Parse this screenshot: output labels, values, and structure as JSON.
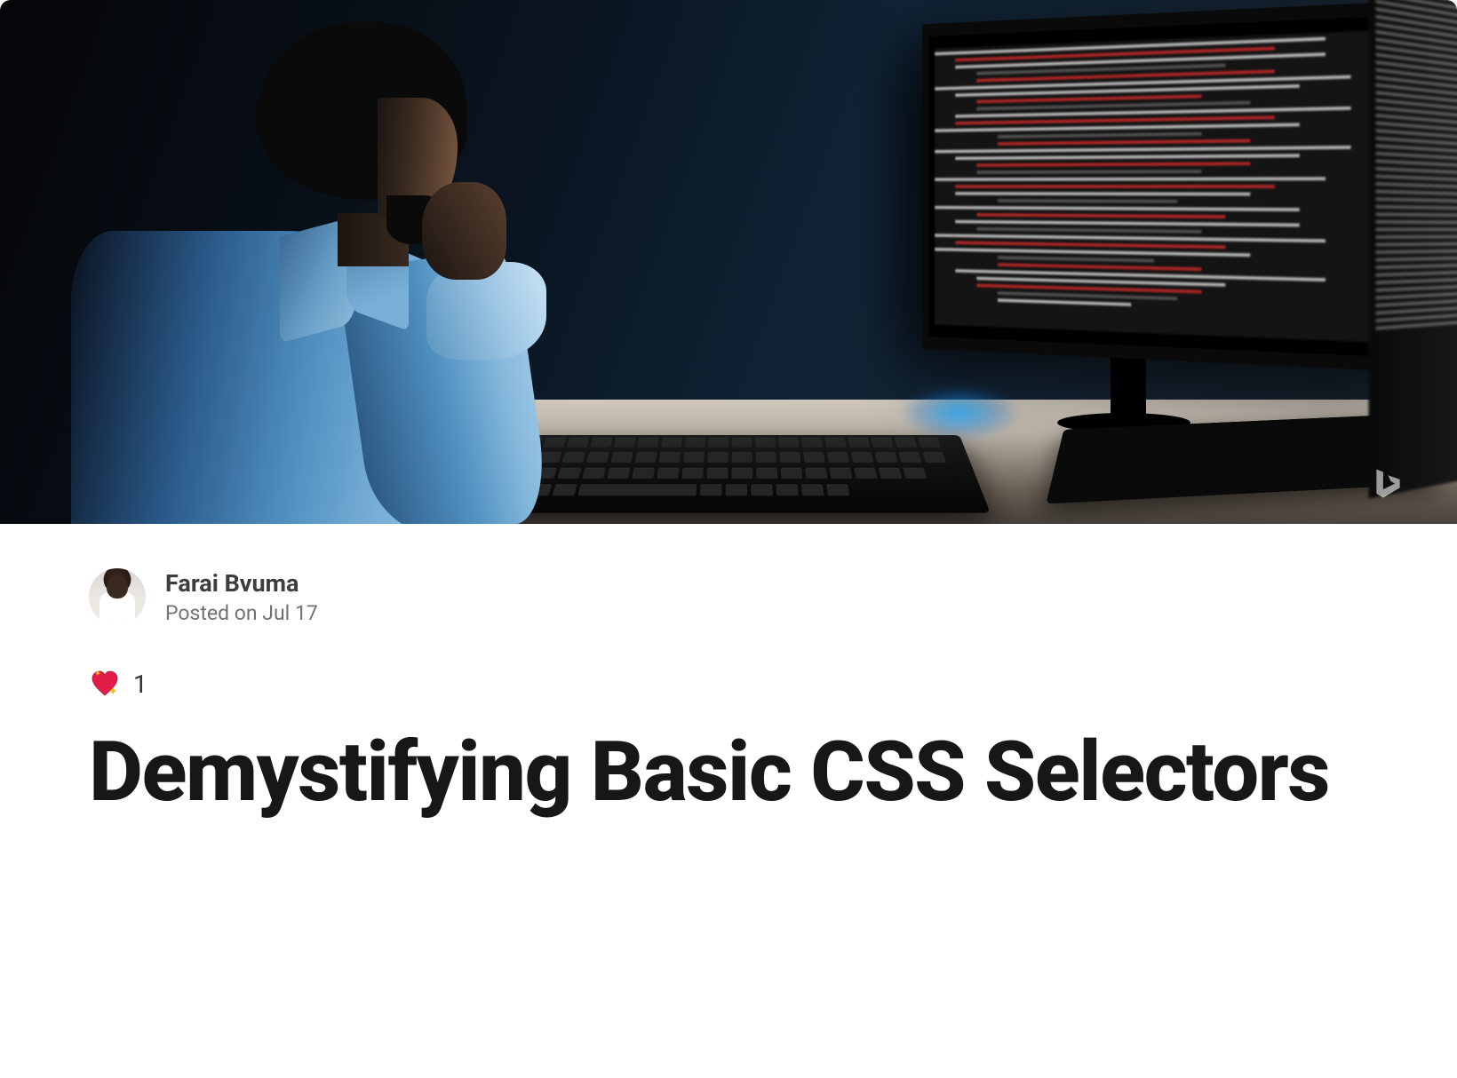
{
  "article": {
    "title": "Demystifying Basic CSS Selectors",
    "author": {
      "name": "Farai Bvuma",
      "posted_prefix": "Posted on ",
      "posted_date": "Jul 17"
    },
    "reactions": {
      "heart_count": "1"
    },
    "hero": {
      "description": "Person in blue shirt at desk looking at monitor with code"
    }
  }
}
